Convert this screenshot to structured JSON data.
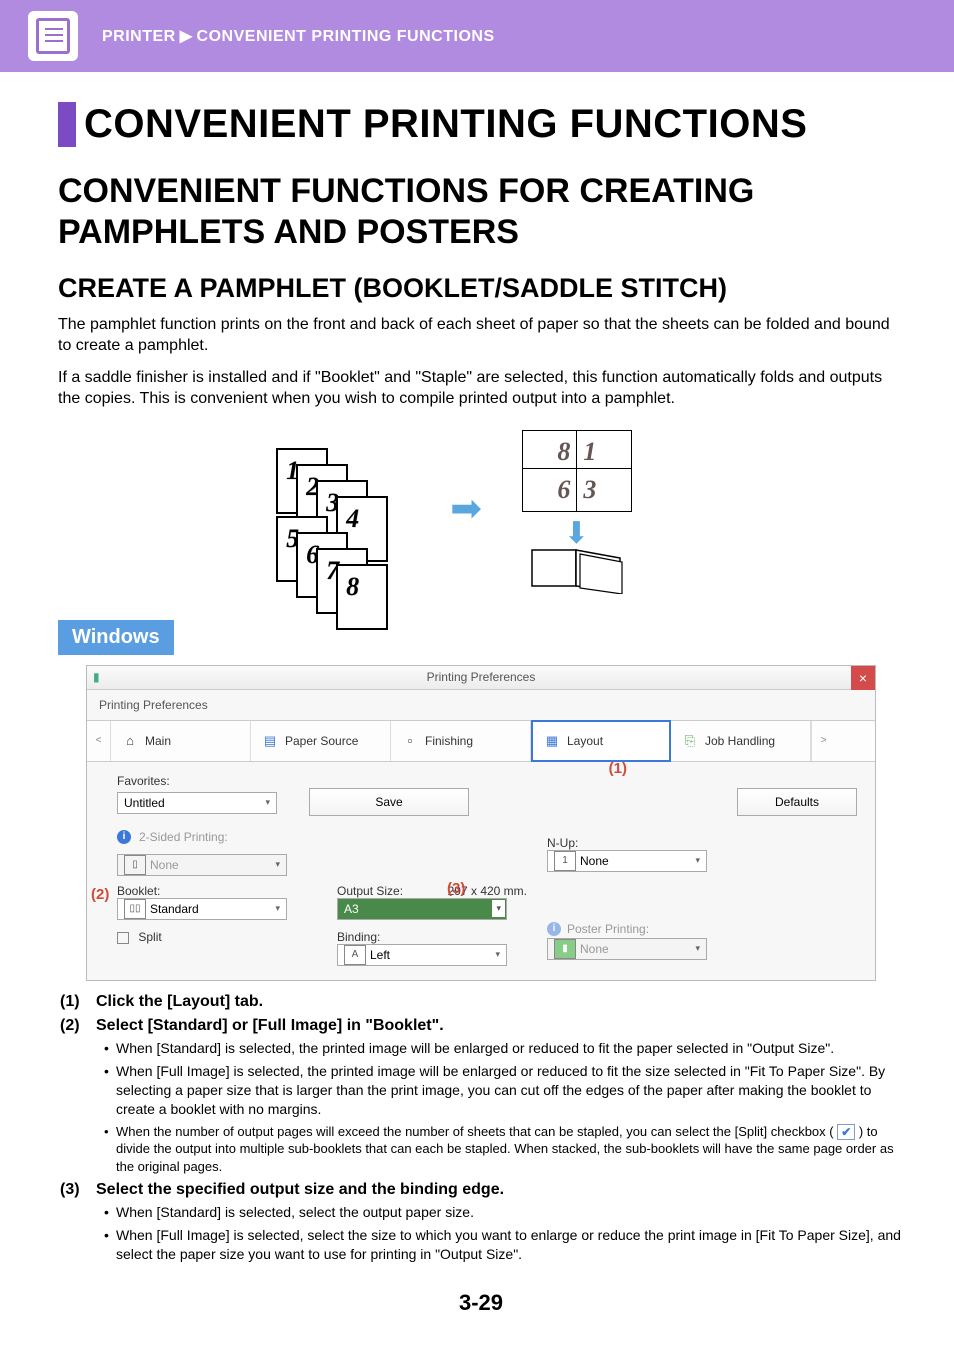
{
  "breadcrumb": {
    "cat": "PRINTER",
    "page": "CONVENIENT PRINTING FUNCTIONS"
  },
  "title": "CONVENIENT PRINTING FUNCTIONS",
  "section1": "CONVENIENT FUNCTIONS FOR CREATING PAMPHLETS AND POSTERS",
  "section2": "CREATE A PAMPHLET (BOOKLET/SADDLE STITCH)",
  "para1": "The pamphlet function prints on the front and back of each sheet of paper so that the sheets can be folded and bound to create a pamphlet.",
  "para2": "If a saddle finisher is installed and if \"Booklet\" and \"Staple\" are selected, this function automatically folds and outputs the copies. This is convenient when you wish to compile printed output into a pamphlet.",
  "diagram": {
    "left": [
      "1",
      "2",
      "3",
      "4",
      "5",
      "6",
      "7",
      "8"
    ],
    "right": [
      [
        "8",
        "1"
      ],
      [
        "6",
        "3"
      ]
    ]
  },
  "os_tag": "Windows",
  "dlg": {
    "title": "Printing Preferences",
    "close": "×",
    "tab_label": "Printing Preferences",
    "nav_prev": "<",
    "nav_next": ">",
    "tabs": {
      "main": "Main",
      "paper_source": "Paper Source",
      "finishing": "Finishing",
      "layout": "Layout",
      "job_handling": "Job Handling"
    },
    "favorites_lbl": "Favorites:",
    "favorites_val": "Untitled",
    "save_btn": "Save",
    "defaults_btn": "Defaults",
    "twosided_lbl": "2-Sided Printing:",
    "twosided_val": "None",
    "nup_lbl": "N-Up:",
    "nup_val": "None",
    "nup_num": "1",
    "booklet_lbl": "Booklet:",
    "booklet_val": "Standard",
    "split_lbl": "Split",
    "output_lbl": "Output Size:",
    "output_dims": "297 x 420 mm.",
    "output_val": "A3",
    "binding_lbl": "Binding:",
    "binding_val": "Left",
    "poster_lbl": "Poster Printing:",
    "poster_val": "None",
    "callout1": "(1)",
    "callout2": "(2)",
    "callout3": "(3)"
  },
  "steps": {
    "s1": {
      "num": "(1)",
      "head": "Click the [Layout] tab."
    },
    "s2": {
      "num": "(2)",
      "head": "Select [Standard] or [Full Image] in \"Booklet\".",
      "b1": "When [Standard] is selected, the printed image will be enlarged or reduced to fit the paper selected in \"Output Size\".",
      "b2": "When [Full Image] is selected, the printed image will be enlarged or reduced to fit the size selected in \"Fit To Paper Size\". By selecting a paper size that is larger than the print image, you can cut off the edges of the paper after making the booklet to create a booklet with no margins.",
      "b3a": "When the number of output pages will exceed the number of sheets that can be stapled, you can select the [Split] checkbox (",
      "b3b": ") to divide the output into multiple sub-booklets that can each be stapled. When stacked, the sub-booklets will have the same page order as the original pages."
    },
    "s3": {
      "num": "(3)",
      "head": "Select the specified output size and the binding edge.",
      "b1": "When [Standard] is selected, select the output paper size.",
      "b2": "When [Full Image] is selected, select the size to which you want to enlarge or reduce the print image in [Fit To Paper Size], and select the paper size you want to use for printing in \"Output Size\"."
    }
  },
  "page_number": "3-29"
}
